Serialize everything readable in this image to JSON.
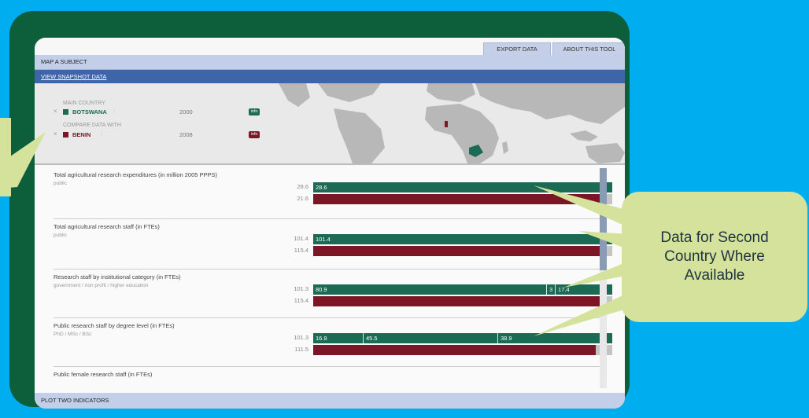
{
  "toolbar": {
    "export_label": "EXPORT DATA",
    "about_label": "ABOUT THIS TOOL"
  },
  "subject_bar": {
    "label": "MAP A SUBJECT"
  },
  "snapshot_bar": {
    "label": "VIEW SNAPSHOT DATA"
  },
  "selector": {
    "main_label": "MAIN COUNTRY",
    "main_country": "BOTSWANA",
    "main_year": "2000",
    "compare_label": "COMPARE DATA WITH",
    "compare_country": "BENIN",
    "compare_year": "2008",
    "info_label": "info",
    "remove_symbol": "×",
    "dropdown_symbol": "⁞"
  },
  "colors": {
    "main": "#1b6a54",
    "compare": "#7a1626",
    "other": "#c4c4c4",
    "background": "#00aeef",
    "callout": "#d5e29b"
  },
  "indicators": [
    {
      "title": "Total agricultural research expenditures (in million 2005 PPPS)",
      "subtitle": "public",
      "main_total": "28.6",
      "compare_total": "21.6",
      "main_segments": [
        "28.6"
      ],
      "main_fractions": [
        1.0
      ],
      "compare_fraction": 0.98
    },
    {
      "title": "Total agricultural research staff (in FTEs)",
      "subtitle": "public",
      "main_total": "101.4",
      "compare_total": "115.4",
      "main_segments": [
        "101.4"
      ],
      "main_fractions": [
        1.0
      ],
      "compare_fraction": 0.98
    },
    {
      "title": "Research staff by institutional category (in FTEs)",
      "subtitle": "government / non profit / higher education",
      "main_total": "101.3",
      "compare_total": "115.4",
      "main_segments": [
        "80.9",
        "3",
        "17.4"
      ],
      "main_fractions": [
        0.78,
        0.03,
        0.17
      ],
      "compare_fraction": 0.96
    },
    {
      "title": "Public research staff by degree level (in FTEs)",
      "subtitle": "PhD / MSc / BSc",
      "main_total": "101.3",
      "compare_total": "111.5",
      "main_segments": [
        "16.9",
        "45.5",
        "38.9"
      ],
      "main_fractions": [
        0.167,
        0.449,
        0.384
      ],
      "compare_fraction": 0.945
    },
    {
      "title": "Public female research staff (in FTEs)",
      "subtitle": "",
      "main_total": "",
      "compare_total": "",
      "main_segments": [],
      "main_fractions": [],
      "compare_fraction": 0
    }
  ],
  "bottom_bar": {
    "label": "PLOT TWO INDICATORS"
  },
  "callout": {
    "text": "Data for Second\nCountry Where\nAvailable"
  }
}
